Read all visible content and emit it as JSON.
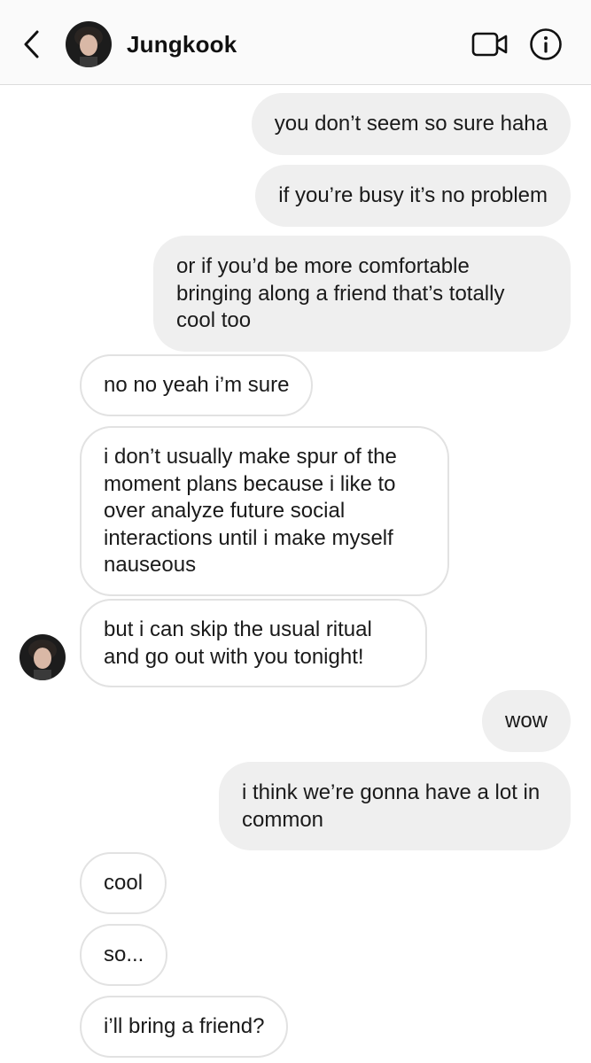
{
  "header": {
    "title": "Jungkook",
    "back_icon": "chevron-left-icon",
    "video_icon": "video-camera-icon",
    "info_icon": "info-icon"
  },
  "colors": {
    "sent_bubble": "#efefef",
    "received_border": "#e2e2e2",
    "header_bg": "#fafafa"
  },
  "messages": [
    {
      "direction": "sent",
      "text": "you don’t seem so sure haha"
    },
    {
      "direction": "sent",
      "text": "if you’re busy it’s no problem"
    },
    {
      "direction": "sent",
      "text": "or if you’d be more comfortable bringing along a friend that’s totally cool too"
    },
    {
      "direction": "received",
      "text": "no no yeah i’m sure"
    },
    {
      "direction": "received",
      "text": "i don’t usually make spur of the moment plans because i like to over analyze future social interactions until i make myself nauseous"
    },
    {
      "direction": "received",
      "text": "but i can skip the usual ritual and go out with you tonight!"
    },
    {
      "direction": "sent",
      "text": "wow"
    },
    {
      "direction": "sent",
      "text": "i think we’re gonna have a lot in common"
    },
    {
      "direction": "received",
      "text": "cool"
    },
    {
      "direction": "received",
      "text": "so..."
    },
    {
      "direction": "received",
      "text": "i’ll bring a friend?"
    }
  ]
}
